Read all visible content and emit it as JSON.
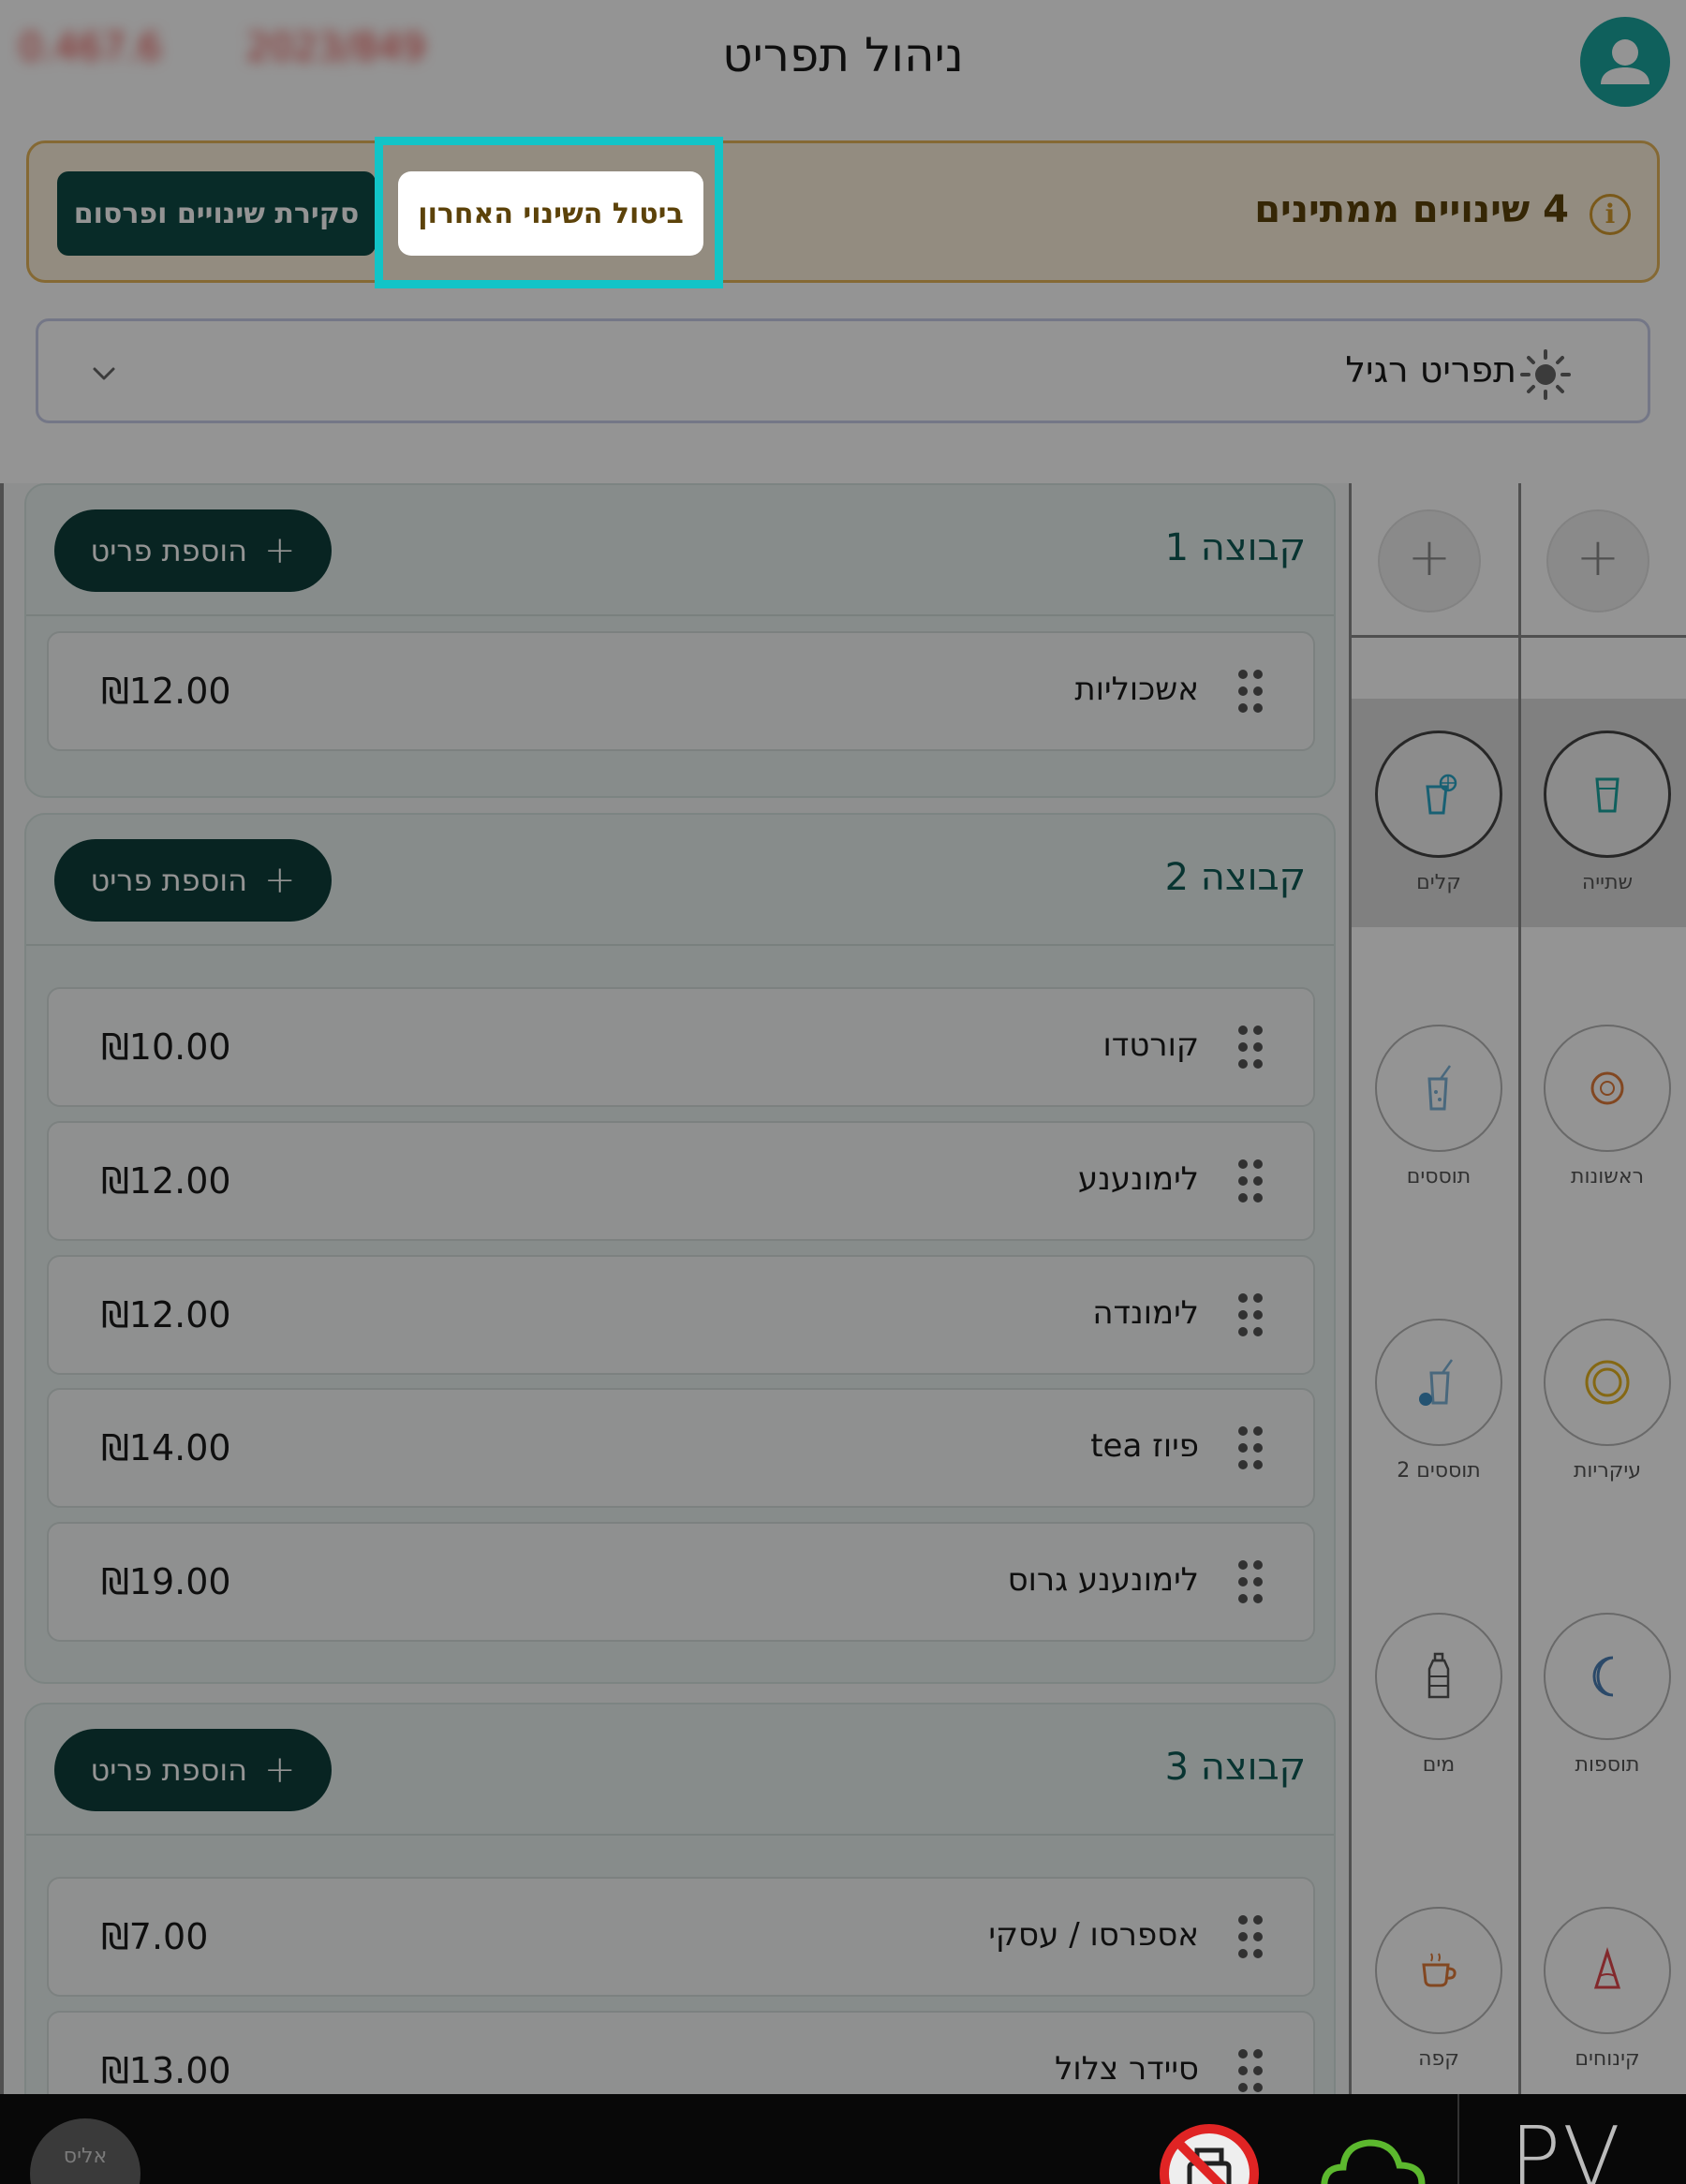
{
  "header": {
    "title": "ניהול תפריט",
    "blurred_info": [
      "0.467.6",
      "2023/849"
    ]
  },
  "banner": {
    "pending_text": "4 שינויים ממתינים",
    "undo_label": "ביטול השינוי האחרון",
    "review_label": "סקירת שינויים ופרסום"
  },
  "menu_select": {
    "value": "תפריט רגיל"
  },
  "groups": [
    {
      "title": "קבוצה 1",
      "add_label": "הוספת פריט",
      "items": [
        {
          "name": "אשכוליות",
          "price": "₪12.00"
        }
      ]
    },
    {
      "title": "קבוצה 2",
      "add_label": "הוספת פריט",
      "items": [
        {
          "name": "קורטדו",
          "price": "₪10.00"
        },
        {
          "name": "לימונענע",
          "price": "₪12.00"
        },
        {
          "name": "לימונדה",
          "price": "₪12.00"
        },
        {
          "name": "פיוז tea",
          "price": "₪14.00"
        },
        {
          "name": "לימונענע גרוס",
          "price": "₪19.00"
        }
      ]
    },
    {
      "title": "קבוצה 3",
      "add_label": "הוספת פריט",
      "items": [
        {
          "name": "אספרסו / עסקי",
          "price": "₪7.00"
        },
        {
          "name": "סיידר צלול",
          "price": "₪13.00"
        }
      ]
    }
  ],
  "categories": {
    "right_column": [
      {
        "label": "שתייה",
        "icon": "cup-icon",
        "color": "#1aa5a0",
        "selected": true
      },
      {
        "label": "ראשונות",
        "icon": "plate-small-icon",
        "color": "#e07b39"
      },
      {
        "label": "עיקריות",
        "icon": "plate-large-icon",
        "color": "#e6b422"
      },
      {
        "label": "תוספות",
        "icon": "half-moon-icon",
        "color": "#4a7fb5"
      },
      {
        "label": "קינוחים",
        "icon": "cake-slice-icon",
        "color": "#e0474c"
      }
    ],
    "left_column": [
      {
        "label": "קלים",
        "icon": "soda-cup-icon",
        "color": "#2aa6c7",
        "selected": true
      },
      {
        "label": "תוססים",
        "icon": "fizzy-drink-icon",
        "color": "#7fb4d8"
      },
      {
        "label": "תוססים 2",
        "icon": "fizzy-drink-2-icon",
        "color": "#3f8fc4"
      },
      {
        "label": "מים",
        "icon": "water-bottle-icon",
        "color": "#555555"
      },
      {
        "label": "קפה",
        "icon": "coffee-cup-icon",
        "color": "#e07b39"
      }
    ]
  },
  "bottom_bar": {
    "user_label": "אליס",
    "logo": "PV"
  },
  "colors": {
    "primary": "#0e4a45",
    "highlight": "#12c4c7",
    "banner_bg": "#fdf2dc",
    "banner_border": "#e6b65a"
  }
}
